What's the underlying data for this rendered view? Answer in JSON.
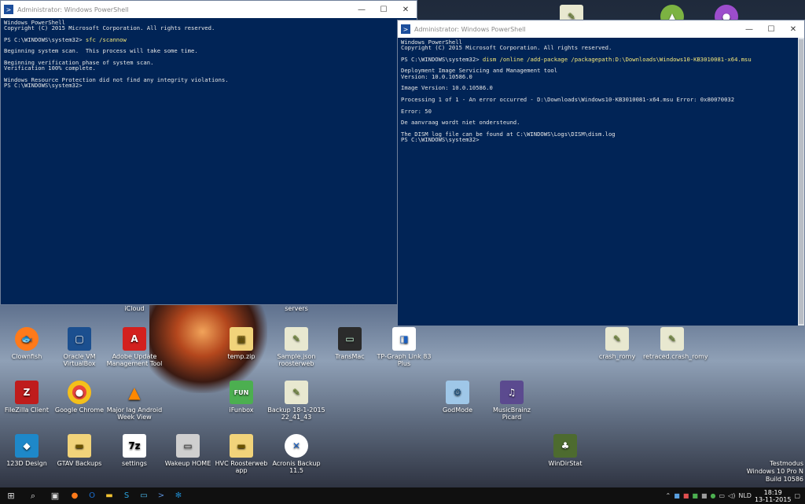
{
  "desktop": {
    "top_icons": [
      {
        "label": "",
        "name": "sample-json-top-icon"
      },
      {
        "label": "",
        "name": "android-top-icon"
      },
      {
        "label": "",
        "name": "github-top-icon"
      }
    ],
    "partial_labels": {
      "cloud": "iCloud",
      "servers": "servers"
    },
    "icons": [
      {
        "label": "Clownfish"
      },
      {
        "label": "Oracle VM VirtualBox"
      },
      {
        "label": "Adobe Update Management Tool"
      },
      {
        "label": "temp.zip"
      },
      {
        "label": "Sample.json roosterweb"
      },
      {
        "label": "TransMac"
      },
      {
        "label": "TP-Graph Link 83 Plus"
      },
      {
        "label": "crash_romy"
      },
      {
        "label": "retraced.crash_romy"
      },
      {
        "label": "FileZilla Client"
      },
      {
        "label": "Google Chrome"
      },
      {
        "label": "Major lag Android Week View"
      },
      {
        "label": "iFunbox"
      },
      {
        "label": "Backup 18-1-2015 22_41_43"
      },
      {
        "label": "GodMode"
      },
      {
        "label": "MusicBrainz Picard"
      },
      {
        "label": "123D Design"
      },
      {
        "label": "GTAV Backups"
      },
      {
        "label": "settings"
      },
      {
        "label": "Wakeup HOME"
      },
      {
        "label": "HVC Roosterweb app"
      },
      {
        "label": "Acronis Backup 11.5"
      },
      {
        "label": "WinDirStat"
      }
    ],
    "watermark": [
      "Testmodus",
      "Windows 10 Pro N",
      "Build 10586"
    ]
  },
  "window_left": {
    "title": "Administrator: Windows PowerShell",
    "lines": [
      "Windows PowerShell",
      "Copyright (C) 2015 Microsoft Corporation. All rights reserved.",
      "",
      "PS C:\\WINDOWS\\system32> ",
      "",
      "Beginning system scan.  This process will take some time.",
      "",
      "Beginning verification phase of system scan.",
      "Verification 100% complete.",
      "",
      "Windows Resource Protection did not find any integrity violations.",
      "PS C:\\WINDOWS\\system32>"
    ],
    "command": "sfc /scannow"
  },
  "window_right": {
    "title": "Administrator: Windows PowerShell",
    "lines": [
      "Windows PowerShell",
      "Copyright (C) 2015 Microsoft Corporation. All rights reserved.",
      "",
      "PS C:\\WINDOWS\\system32> ",
      "",
      "Deployment Image Servicing and Management tool",
      "Version: 10.0.10586.0",
      "",
      "Image Version: 10.0.10586.0",
      "",
      "Processing 1 of 1 - An error occurred - D:\\Downloads\\Windows10-KB3010081-x64.msu Error: 0x80070032",
      "",
      "Error: 50",
      "",
      "De aanvraag wordt niet ondersteund.",
      "",
      "The DISM log file can be found at C:\\WINDOWS\\Logs\\DISM\\dism.log",
      "PS C:\\WINDOWS\\system32>"
    ],
    "command": "dism /online /add-package /packagepath:D:\\Downloads\\Windows10-KB3010081-x64.msu"
  },
  "taskbar": {
    "apps": [
      "firefox-icon",
      "outlook-icon",
      "file-explorer-icon",
      "skype-icon",
      "remote-desktop-icon",
      "powershell-icon",
      "settings-app-icon"
    ],
    "language": "NLD",
    "time": "18:19",
    "date": "13-11-2015"
  }
}
